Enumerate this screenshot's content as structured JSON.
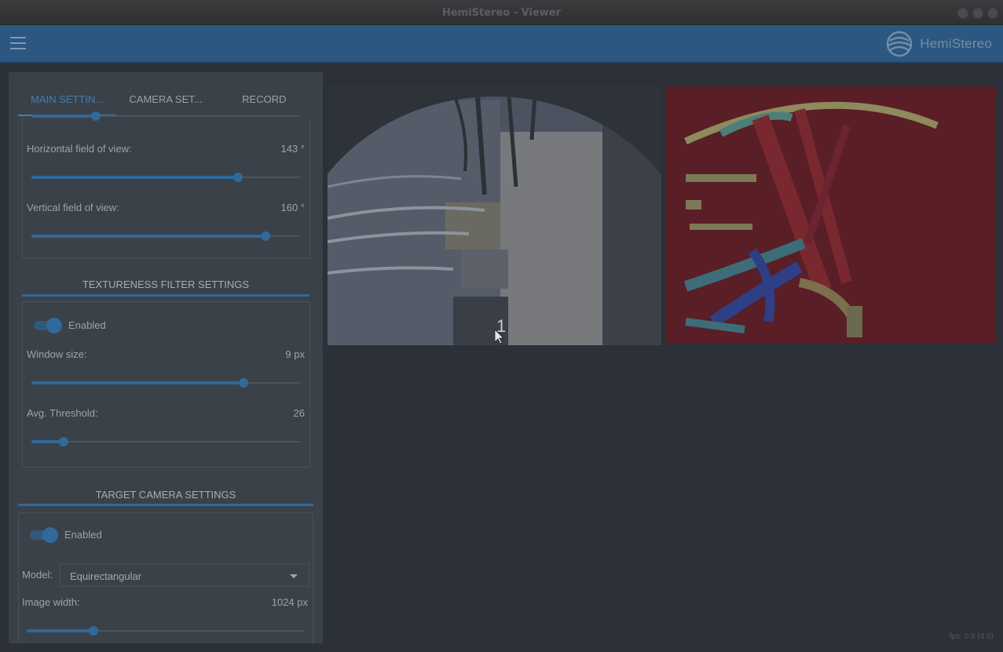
{
  "window": {
    "title": "HemiStereo - Viewer"
  },
  "header": {
    "brand": "HemiStereo"
  },
  "tabs": [
    {
      "label": "MAIN SETTIN..."
    },
    {
      "label": "CAMERA SET..."
    },
    {
      "label": "RECORD"
    }
  ],
  "fov": {
    "horizontal": {
      "label": "Horizontal field of view:",
      "value": "143 °",
      "level": 0.77
    },
    "vertical": {
      "label": "Vertical field of view:",
      "value": "160 °",
      "level": 0.87
    }
  },
  "textureness": {
    "title": "TEXTURENESS FILTER SETTINGS",
    "enabled_label": "Enabled",
    "window_size": {
      "label": "Window size:",
      "value": "9 px",
      "level": 0.79
    },
    "avg_threshold": {
      "label": "Avg. Threshold:",
      "value": "26",
      "level": 0.12
    }
  },
  "target_camera": {
    "title": "TARGET CAMERA SETTINGS",
    "enabled_label": "Enabled",
    "model_label": "Model:",
    "model_value": "Equirectangular",
    "image_width": {
      "label": "Image width:",
      "value": "1024 px",
      "level": 0.24
    }
  },
  "viewer": {
    "frame_counter": "1"
  },
  "status": {
    "fps": "fps: 0.8 (4.0)"
  },
  "colors": {
    "accent": "#2f6a9b",
    "header": "#2c5780",
    "background": "#2c3038",
    "panel": "#3b4148"
  }
}
